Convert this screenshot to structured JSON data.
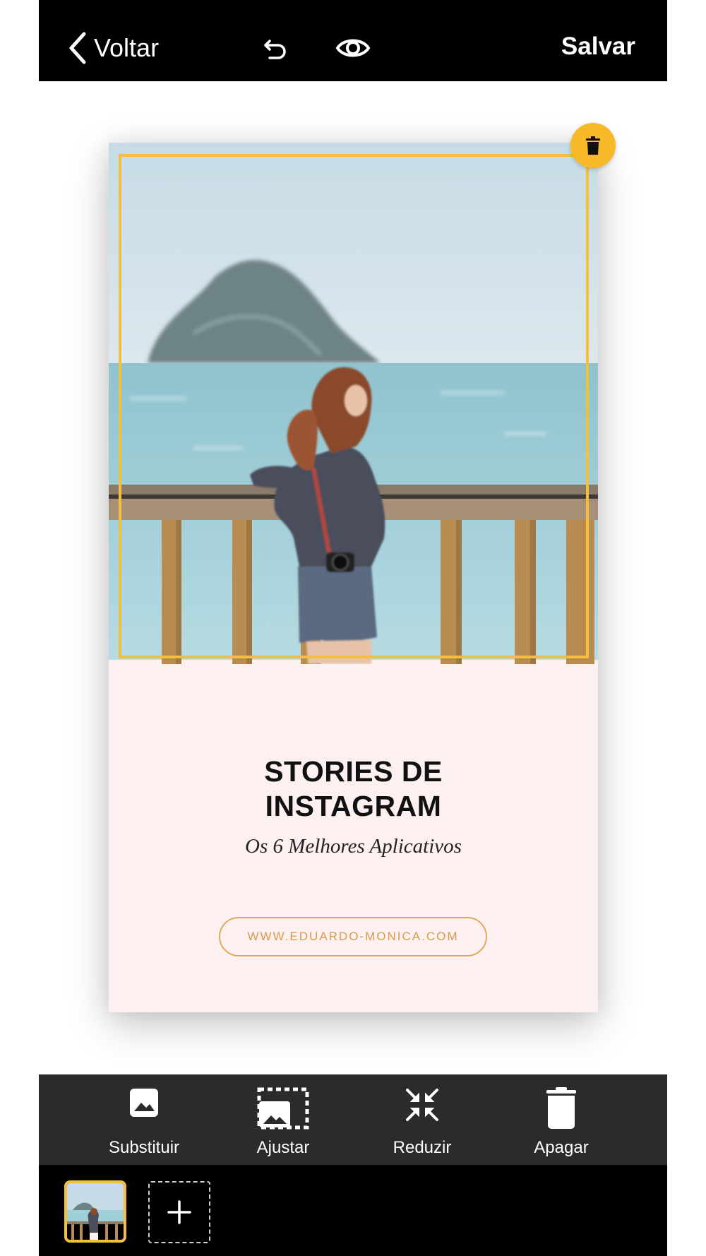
{
  "topbar": {
    "back_label": "Voltar",
    "save_label": "Salvar",
    "icons": [
      "chevron-left-icon",
      "undo-icon",
      "eye-icon"
    ]
  },
  "canvas": {
    "headline_line1": "STORIES DE",
    "headline_line2": "INSTAGRAM",
    "subtitle": "Os 6 Melhores Aplicativos",
    "url": "WWW.EDUARDO-MONICA.COM",
    "selection_color": "#f4bf3f",
    "background_color": "#fdf0f1"
  },
  "toolbar": {
    "items": [
      {
        "label": "Substituir",
        "icon": "image-icon"
      },
      {
        "label": "Ajustar",
        "icon": "fit-image-icon"
      },
      {
        "label": "Reduzir",
        "icon": "shrink-icon"
      },
      {
        "label": "Apagar",
        "icon": "trash-icon"
      }
    ]
  },
  "pages": {
    "add_icon": "plus-icon"
  },
  "colors": {
    "accent": "#f7b928",
    "bar_dark": "#000000",
    "toolbar_bg": "#2b2b2b"
  }
}
